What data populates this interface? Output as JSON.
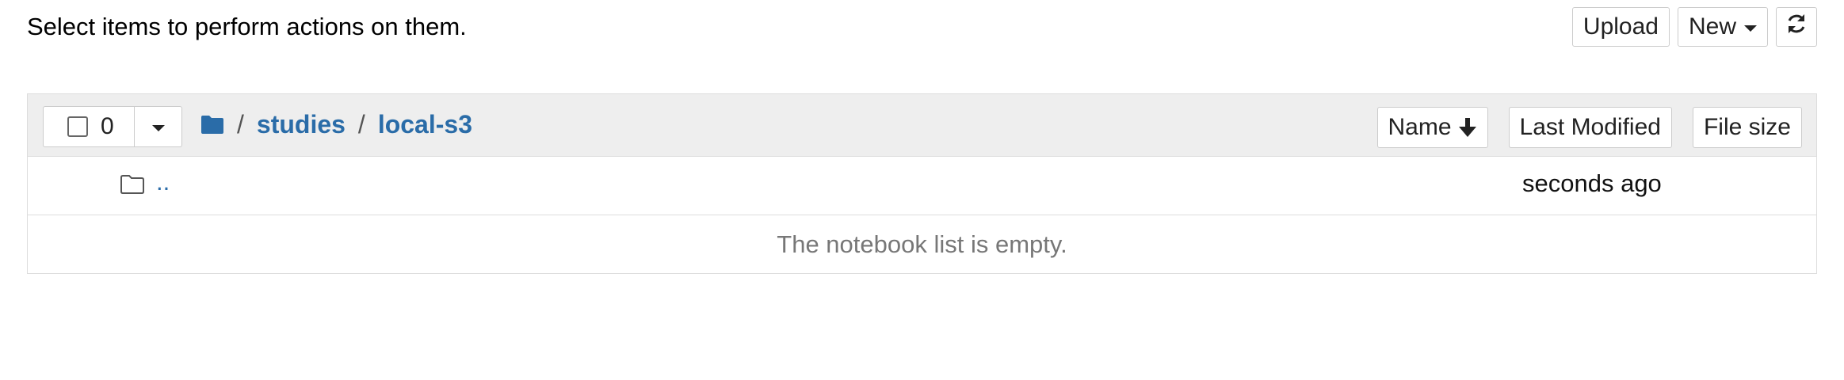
{
  "intro_text": "Select items to perform actions on them.",
  "toolbar": {
    "upload_label": "Upload",
    "new_label": "New",
    "refresh_icon": "refresh-icon"
  },
  "list_header": {
    "selected_count": "0",
    "breadcrumb": {
      "home_icon": "folder-icon",
      "separator": "/",
      "items": [
        "studies",
        "local-s3"
      ]
    },
    "sort": {
      "name_label": "Name",
      "name_sort_icon": "arrow-down-icon",
      "last_modified_label": "Last Modified",
      "file_size_label": "File size"
    }
  },
  "rows": [
    {
      "icon": "folder-outline-icon",
      "name": "..",
      "modified": "seconds ago"
    }
  ],
  "empty_message": "The notebook list is empty.",
  "colors": {
    "link": "#2a6ca8",
    "header_bg": "#eeeeee",
    "border": "#dddddd",
    "muted_text": "#777777"
  }
}
